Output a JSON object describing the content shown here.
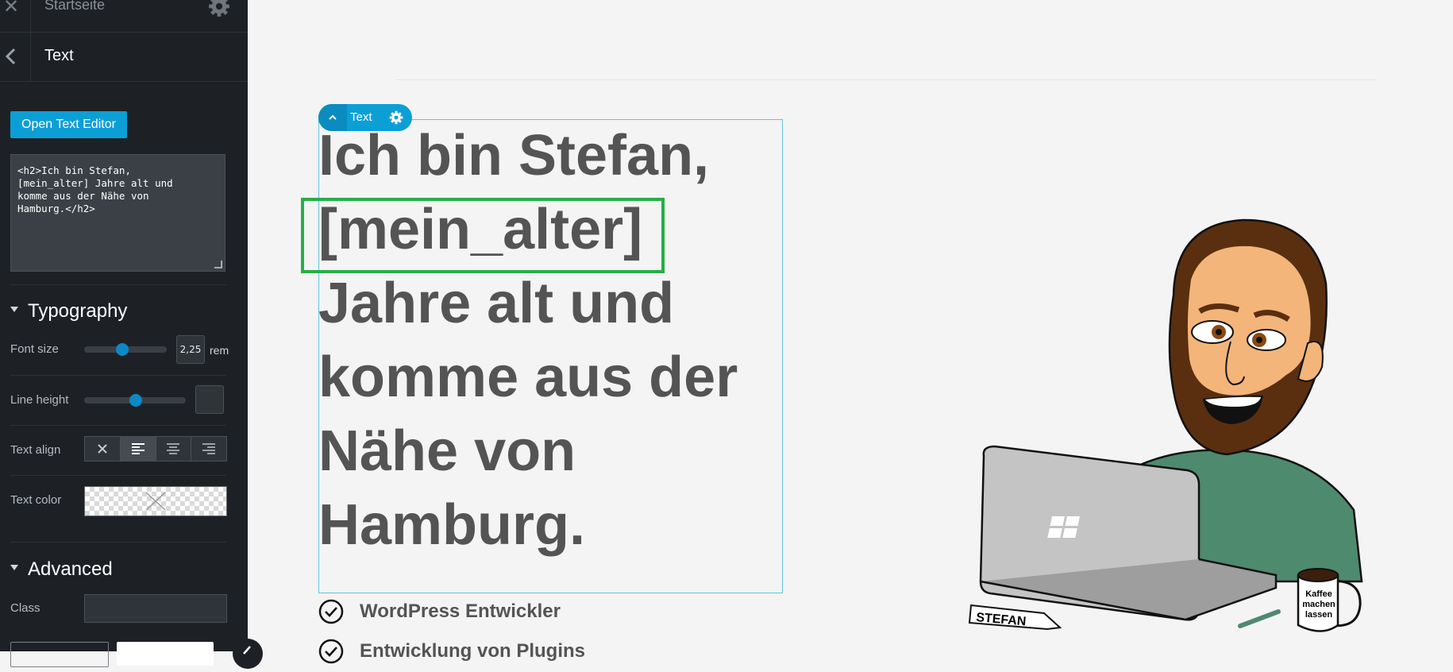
{
  "topbar": {
    "title": "Startseite",
    "close_icon": "close-icon",
    "settings_icon": "gear-icon"
  },
  "subbar": {
    "title": "Text",
    "back_icon": "chevron-left-icon"
  },
  "editor": {
    "open_button": "Open Text Editor",
    "code": "<h2>Ich bin Stefan,\n[mein_alter] Jahre alt und\nkomme aus der Nähe von\nHamburg.</h2>"
  },
  "typography": {
    "title": "Typography",
    "font_size": {
      "label": "Font size",
      "value": "2,25",
      "unit": "rem"
    },
    "line_height": {
      "label": "Line height",
      "value": ""
    },
    "text_align": {
      "label": "Text align",
      "options": [
        "none",
        "left",
        "center",
        "right"
      ],
      "selected": "left"
    },
    "text_color": {
      "label": "Text color",
      "value": "transparent"
    }
  },
  "advanced": {
    "title": "Advanced",
    "class_label": "Class"
  },
  "canvas": {
    "toolbar_label": "Text",
    "heading_lines": [
      "Ich bin Stefan,",
      "[mein_alter]",
      "Jahre alt und",
      "komme aus der",
      "Nähe von",
      "Hamburg."
    ],
    "features": [
      "WordPress Entwickler",
      "Entwicklung von Plugins"
    ]
  },
  "illustration": {
    "name_tag": "STEFAN",
    "mug_text": [
      "Kaffee",
      "machen",
      "lassen"
    ]
  },
  "colors": {
    "accent": "#0c9fd6",
    "highlight": "#27ae47",
    "panel_bg": "#1d2126",
    "heading": "#545454"
  }
}
